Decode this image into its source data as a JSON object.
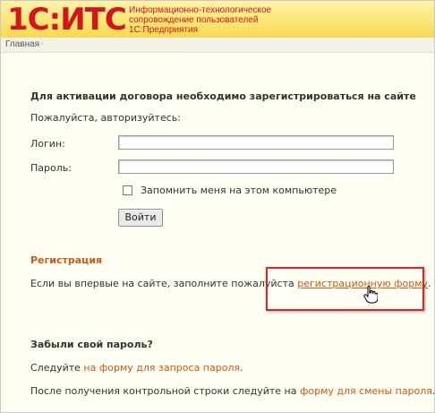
{
  "header": {
    "logo": "1С:ИТС",
    "tagline": [
      "Информационно-технологическое",
      "сопровождение пользователей",
      "1С:Предприятия"
    ]
  },
  "breadcrumb": {
    "home": "Главная"
  },
  "login": {
    "heading": "Для активации договора необходимо зарегистрироваться на сайте",
    "prompt": "Пожалуйста, авторизуйтесь:",
    "login_label": "Логин:",
    "login_value": "",
    "password_label": "Пароль:",
    "password_value": "",
    "remember_label": "Запомнить меня на этом компьютере",
    "submit_label": "Войти"
  },
  "registration": {
    "heading": "Регистрация",
    "text_before": "Если вы впервые на сайте, заполните пожалуйста",
    "link": "регистрационную форму",
    "text_after": "."
  },
  "forgot": {
    "heading": "Забыли свой пароль?",
    "line1_before": "Следуйте",
    "line1_link": "на форму для запроса пароля",
    "line1_after": ".",
    "line2_before": "После получения контрольной строки следуйте на",
    "line2_link": "форму для смены пароля",
    "line2_after": "."
  },
  "colors": {
    "brand": "#d2161d",
    "link": "#c85a1a",
    "highlight": "#d9262b",
    "header": "#f7da4f"
  },
  "icons": {
    "cursor": "hand-pointer-icon"
  }
}
